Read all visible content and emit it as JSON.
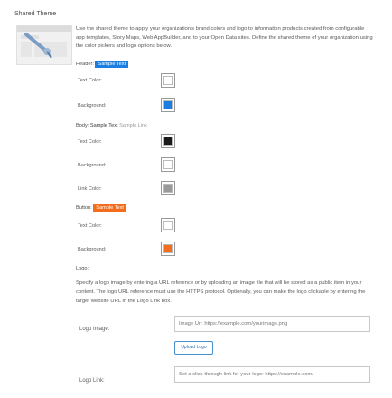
{
  "page": {
    "title": "Shared Theme"
  },
  "description": "Use the shared theme to apply your organization's brand colors and logo to information products created from configurable app templates, Story Maps, Web AppBuilder, and to your Open Data sites. Define the shared theme of your organization using the color pickers and logo options below.",
  "header_section": {
    "label": "Header:",
    "sample": "Sample Text",
    "text_color_label": "Text Color:",
    "text_color": "#ffffff",
    "background_label": "Background:",
    "background_color": "#1a7ee2"
  },
  "body_section": {
    "label": "Body:",
    "sample_text": "Sample Text",
    "sample_link": "Sample Link",
    "text_color_label": "Text Color:",
    "text_color": "#1a1a1a",
    "background_label": "Background:",
    "background_color": "#ffffff",
    "link_color_label": "Link Color:",
    "link_color": "#999999"
  },
  "button_section": {
    "label": "Button:",
    "sample": "Sample Text",
    "text_color_label": "Text Color:",
    "text_color": "#ffffff",
    "background_label": "Background:",
    "background_color": "#f26e1e"
  },
  "logo_section": {
    "label": "Logo:",
    "description": "Specify a logo image by entering a URL reference or by uploading an image file that will be stored as a public item in your content. The logo URL reference must use the HTTPS protocol. Optionally, you can make the logo clickable by entering the target website URL in the Logo Link box.",
    "image_label": "Logo Image:",
    "image_placeholder": "Image Url: https://example.com/yourimage.png",
    "upload_label": "Upload Logo",
    "link_label": "Logo Link:",
    "link_placeholder": "Set a click-through link for your logo: https://example.com/"
  }
}
